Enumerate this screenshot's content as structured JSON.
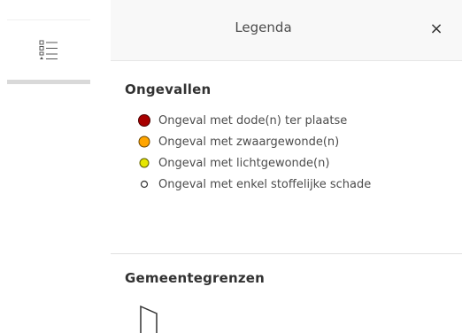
{
  "toolbar": {
    "legend_button_icon": "legend-list-icon"
  },
  "panel": {
    "title": "Legenda",
    "close_label": "×"
  },
  "sections": {
    "accidents": {
      "title": "Ongevallen",
      "items": [
        {
          "label": "Ongeval met dode(n) ter plaatse",
          "fill": "#a80000",
          "stroke": "#4d0000",
          "size": "large"
        },
        {
          "label": "Ongeval met zwaargewonde(n)",
          "fill": "#ffa500",
          "stroke": "#6b4500",
          "size": "large"
        },
        {
          "label": "Ongeval met lichtgewonde(n)",
          "fill": "#e6e600",
          "stroke": "#5c5c00",
          "size": "medium"
        },
        {
          "label": "Ongeval met enkel stoffelijke schade",
          "fill": "#ffffff",
          "stroke": "#333333",
          "size": "small"
        }
      ]
    },
    "municipal": {
      "title": "Gemeentegrenzen"
    }
  },
  "colors": {
    "header_bg": "#f8f8f8",
    "divider": "#e0e0e0"
  }
}
